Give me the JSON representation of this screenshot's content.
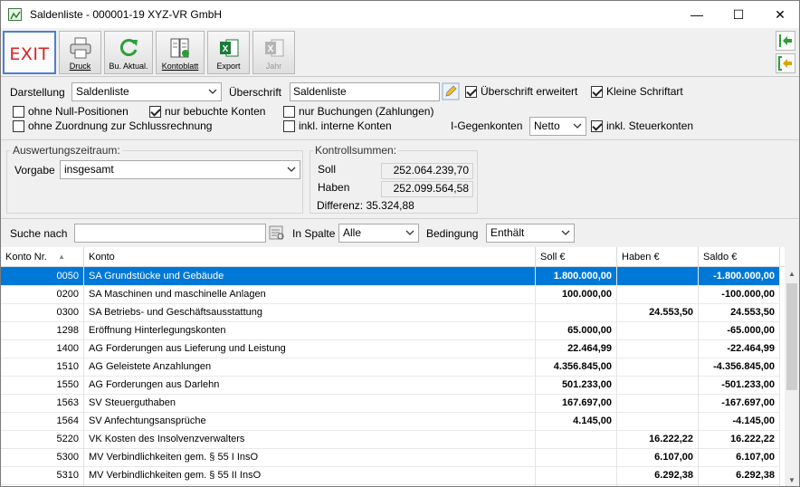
{
  "window": {
    "title": "Saldenliste - 000001-19 XYZ-VR GmbH",
    "min_glyph": "—",
    "max_glyph": "☐",
    "close_glyph": "✕"
  },
  "toolbar": {
    "exit_label": "EXIT",
    "druck_label": "Druck",
    "buakt_label": "Bu. Aktual.",
    "kontoblatt_label": "Kontoblatt",
    "export_label": "Export",
    "jahr_label": "Jahr"
  },
  "options": {
    "darstellung_label": "Darstellung",
    "darstellung_value": "Saldenliste",
    "ueberschrift_label": "Überschrift",
    "ueberschrift_value": "Saldenliste",
    "cb_ueberschrift_erweitert": "Überschrift erweitert",
    "cb_kleine_schriftart": "Kleine Schriftart",
    "cb_ohne_null": "ohne Null-Positionen",
    "cb_nur_bebuchte": "nur bebuchte Konten",
    "cb_nur_buchungen": "nur Buchungen (Zahlungen)",
    "cb_ohne_zuordnung": "ohne Zuordnung zur Schlussrechnung",
    "cb_inkl_interne": "inkl. interne Konten",
    "gegenkonten_label": "I-Gegenkonten",
    "gegenkonten_value": "Netto",
    "cb_inkl_steuer": "inkl. Steuerkonten"
  },
  "auswertung": {
    "title": "Auswertungszeitraum:",
    "vorgabe_label": "Vorgabe",
    "vorgabe_value": "insgesamt"
  },
  "kontroll": {
    "title": "Kontrollsummen:",
    "soll_label": "Soll",
    "soll_value": "252.064.239,70",
    "haben_label": "Haben",
    "haben_value": "252.099.564,58",
    "differenz": "Differenz: 35.324,88"
  },
  "search": {
    "suche_label": "Suche nach",
    "suche_value": "",
    "spalte_label": "In Spalte",
    "spalte_value": "Alle",
    "bedingung_label": "Bedingung",
    "bedingung_value": "Enthält"
  },
  "table": {
    "headers": {
      "nr": "Konto Nr.",
      "konto": "Konto",
      "soll": "Soll €",
      "haben": "Haben €",
      "saldo": "Saldo €"
    },
    "rows": [
      {
        "nr": "0050",
        "konto": "SA Grundstücke und Gebäude",
        "soll": "1.800.000,00",
        "haben": "",
        "saldo": "-1.800.000,00"
      },
      {
        "nr": "0200",
        "konto": "SA Maschinen und maschinelle Anlagen",
        "soll": "100.000,00",
        "haben": "",
        "saldo": "-100.000,00"
      },
      {
        "nr": "0300",
        "konto": "SA Betriebs- und Geschäftsausstattung",
        "soll": "",
        "haben": "24.553,50",
        "saldo": "24.553,50"
      },
      {
        "nr": "1298",
        "konto": "Eröffnung Hinterlegungskonten",
        "soll": "65.000,00",
        "haben": "",
        "saldo": "-65.000,00"
      },
      {
        "nr": "1400",
        "konto": "AG Forderungen aus Lieferung und Leistung",
        "soll": "22.464,99",
        "haben": "",
        "saldo": "-22.464,99"
      },
      {
        "nr": "1510",
        "konto": "AG Geleistete Anzahlungen",
        "soll": "4.356.845,00",
        "haben": "",
        "saldo": "-4.356.845,00"
      },
      {
        "nr": "1550",
        "konto": "AG Forderungen aus Darlehn",
        "soll": "501.233,00",
        "haben": "",
        "saldo": "-501.233,00"
      },
      {
        "nr": "1563",
        "konto": "SV Steuerguthaben",
        "soll": "167.697,00",
        "haben": "",
        "saldo": "-167.697,00"
      },
      {
        "nr": "1564",
        "konto": "SV Anfechtungsansprüche",
        "soll": "4.145,00",
        "haben": "",
        "saldo": "-4.145,00"
      },
      {
        "nr": "5220",
        "konto": "VK Kosten des Insolvenzverwalters",
        "soll": "",
        "haben": "16.222,22",
        "saldo": "16.222,22"
      },
      {
        "nr": "5300",
        "konto": "MV Verbindlichkeiten gem. § 55 I InsO",
        "soll": "",
        "haben": "6.107,00",
        "saldo": "6.107,00"
      },
      {
        "nr": "5310",
        "konto": "MV Verbindlichkeiten gem. § 55 II InsO",
        "soll": "",
        "haben": "6.292,38",
        "saldo": "6.292,38"
      }
    ]
  },
  "colors": {
    "selection": "#0078d7",
    "exit_red": "#dd2222",
    "focus_blue": "#4e7ed3"
  }
}
